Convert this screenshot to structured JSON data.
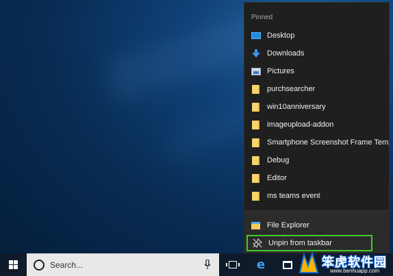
{
  "jumplist": {
    "section_title": "Pinned",
    "pinned": [
      {
        "label": "Desktop",
        "icon": "desktop-icon"
      },
      {
        "label": "Downloads",
        "icon": "download-arrow-icon"
      },
      {
        "label": "Pictures",
        "icon": "pictures-icon"
      },
      {
        "label": "purchsearcher",
        "icon": "folder-icon"
      },
      {
        "label": "win10anniversary",
        "icon": "folder-icon"
      },
      {
        "label": "imageupload-addon",
        "icon": "folder-icon"
      },
      {
        "label": "Smartphone Screenshot Frame Templa...",
        "icon": "folder-icon"
      },
      {
        "label": "Debug",
        "icon": "folder-icon"
      },
      {
        "label": "Editor",
        "icon": "folder-icon"
      },
      {
        "label": "ms teams event",
        "icon": "folder-icon"
      }
    ],
    "app_label": "File Explorer",
    "unpin_label": "Unpin from taskbar",
    "highlight_color": "#3fcf2a"
  },
  "taskbar": {
    "search_placeholder": "Search...",
    "start_icon": "windows-logo-icon",
    "cortana_icon": "cortana-circle-icon",
    "mic_icon": "microphone-icon",
    "taskview_icon": "task-view-icon",
    "edge_icon": "edge-icon",
    "store_icon": "store-icon"
  },
  "watermark": {
    "title": "笨虎软件园",
    "url": "www.benhuapp.com"
  }
}
